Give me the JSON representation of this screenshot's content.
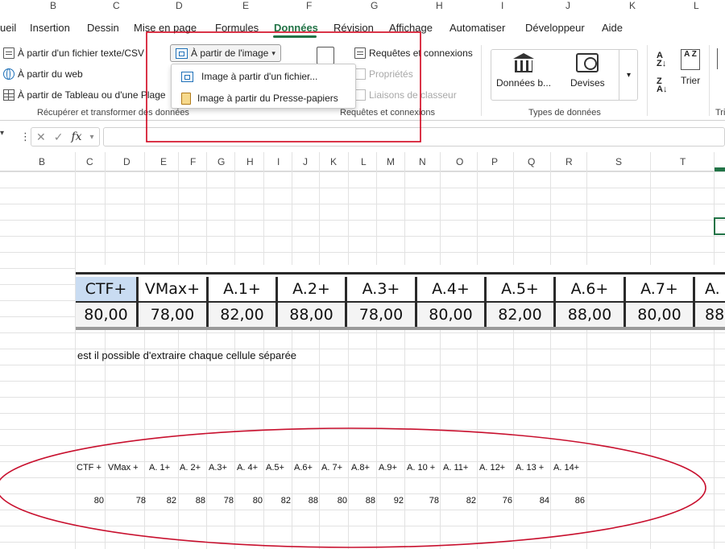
{
  "top_columns": [
    "B",
    "C",
    "D",
    "E",
    "F",
    "G",
    "H",
    "I",
    "J",
    "K",
    "L"
  ],
  "tabs": [
    {
      "label": "ueil",
      "active": false
    },
    {
      "label": "Insertion",
      "active": false
    },
    {
      "label": "Dessin",
      "active": false
    },
    {
      "label": "Mise en page",
      "active": false
    },
    {
      "label": "Formules",
      "active": false
    },
    {
      "label": "Données",
      "active": true
    },
    {
      "label": "Révision",
      "active": false
    },
    {
      "label": "Affichage",
      "active": false
    },
    {
      "label": "Automatiser",
      "active": false
    },
    {
      "label": "Développeur",
      "active": false
    },
    {
      "label": "Aide",
      "active": false
    }
  ],
  "ribbon": {
    "get_data": {
      "from_text": "À partir d'un fichier texte/CSV",
      "from_web": "À partir du web",
      "from_table": "À partir de Tableau ou d'une Plage",
      "from_image": "À partir de l'image",
      "group_label": "Récupérer et transformer des données"
    },
    "image_menu": {
      "from_file": "Image à partir d'un fichier...",
      "from_clipboard": "Image à partir du Presse-papiers"
    },
    "queries": {
      "queries_connections": "Requêtes et connexions",
      "properties": "Propriétés",
      "workbook_links": "Liaisons de classeur",
      "group_label": "Requêtes et connexions"
    },
    "data_types": {
      "stocks": "Données b...",
      "currencies": "Devises",
      "group_label": "Types de données"
    },
    "sort": {
      "sort_label": "Trier",
      "az": "A Z",
      "group_label_partial": "Tri"
    }
  },
  "formula_bar": {
    "fx": "fx",
    "value": ""
  },
  "grid_columns": [
    "B",
    "C",
    "D",
    "E",
    "F",
    "G",
    "H",
    "I",
    "J",
    "K",
    "L",
    "M",
    "N",
    "O",
    "P",
    "Q",
    "R",
    "S",
    "T"
  ],
  "pasted_image": {
    "headers": [
      "CTF+",
      "VMax+",
      "A.1+",
      "A.2+",
      "A.3+",
      "A.4+",
      "A.5+",
      "A.6+",
      "A.7+",
      "A."
    ],
    "values": [
      "80,00",
      "78,00",
      "82,00",
      "88,00",
      "78,00",
      "80,00",
      "82,00",
      "88,00",
      "80,00",
      "88"
    ]
  },
  "question_text": "est il possible d'extraire chaque cellule séparée",
  "extracted": {
    "headers": [
      "CTF +",
      "VMax +",
      "A. 1+",
      "A. 2+",
      "A.3+",
      "A. 4+",
      "A.5+",
      "A.6+",
      "A. 7+",
      "A.8+",
      "A.9+",
      "A. 10 +",
      "A. 11+",
      "A. 12+",
      "A. 13 +",
      "A. 14+"
    ],
    "values": [
      "80",
      "78",
      "82",
      "88",
      "78",
      "80",
      "82",
      "88",
      "80",
      "88",
      "92",
      "78",
      "82",
      "76",
      "84",
      "86"
    ]
  },
  "colors": {
    "accent": "#217346",
    "annotation": "#d0021b"
  }
}
